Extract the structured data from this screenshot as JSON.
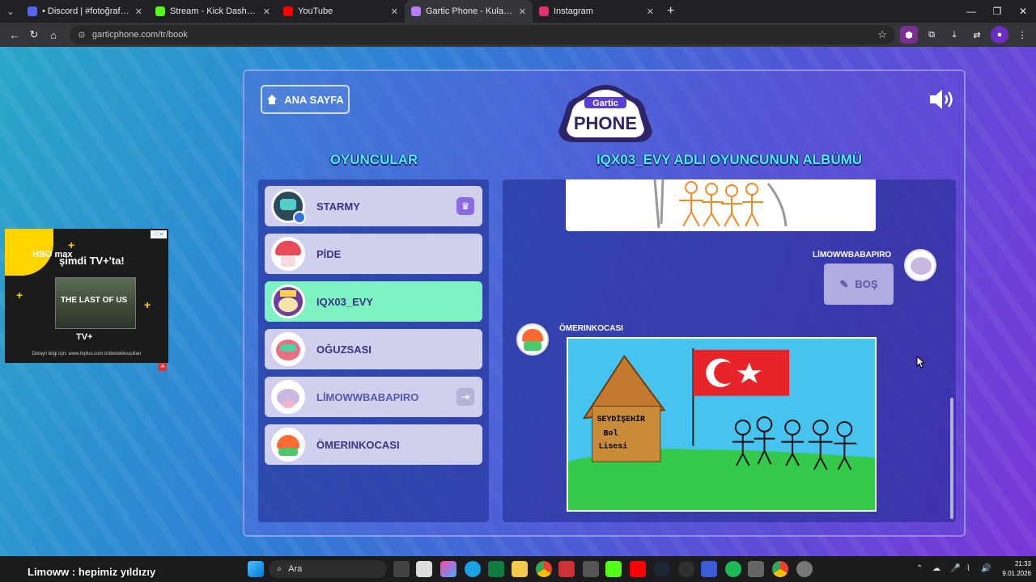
{
  "browser": {
    "tabs": [
      {
        "title": "• Discord | #fotoğraf | Starr",
        "color": "#5865f2"
      },
      {
        "title": "Stream - Kick Dashboard",
        "color": "#53fc18"
      },
      {
        "title": "YouTube",
        "color": "#ff0000"
      },
      {
        "title": "Gartic Phone - Kulaktan Kulağa",
        "color": "#b57bff"
      },
      {
        "title": "Instagram",
        "color": "#e1306c"
      }
    ],
    "url": "garticphone.com/tr/book"
  },
  "game": {
    "home_label": "ANA SAYFA",
    "logo_top": "Gartic",
    "logo_bottom": "PHONE",
    "players_heading": "OYUNCULAR",
    "album_heading": "IQX03_EVY ADLI OYUNCUNUN ALBÜMÜ",
    "players": [
      {
        "name": "STARMY",
        "badge": "crown",
        "avatar_color": "#2c4a5a"
      },
      {
        "name": "PİDE",
        "badge": "",
        "avatar_color": "#e85a6a"
      },
      {
        "name": "IQX03_EVY",
        "badge": "",
        "avatar_color": "#6a3fa0",
        "active": true
      },
      {
        "name": "OĞUZSASI",
        "badge": "",
        "avatar_color": "#e87080"
      },
      {
        "name": "LİMOWWBABAPIRO",
        "badge": "exit",
        "avatar_color": "#c9b8e0"
      },
      {
        "name": "ÖMERINKOCASI",
        "badge": "",
        "avatar_color": "#ff6a33"
      }
    ],
    "album": {
      "entry1_author": "LİMOWWBABAPIRO",
      "entry1_empty_label": "BOŞ",
      "entry2_author": "ÖMERINKOCASI",
      "drawing_text": [
        "SEYDİŞEHİR",
        "Bol",
        "Lisesi"
      ]
    }
  },
  "ad": {
    "brand": "HBO max",
    "headline": "şimdi TV+'ta!",
    "poster_title": "THE LAST OF US",
    "footer": "Detaylı bilgi için: www.tvplus.com.tr/destekkoşulları"
  },
  "taskbar": {
    "overlay_chat": "Limoww : hepimiz yıldızıy",
    "search_label": "Ara",
    "time": "21:33",
    "date": "9.01.2026"
  }
}
